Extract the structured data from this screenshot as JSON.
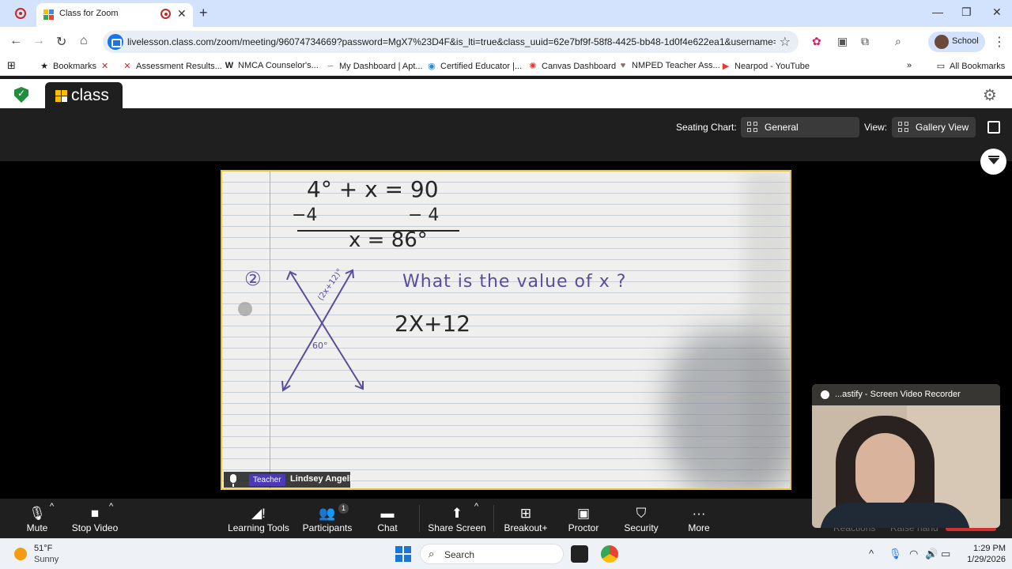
{
  "browser": {
    "tab_title": "Class for Zoom",
    "new_tab": "+",
    "url": "livelesson.class.com/zoom/meeting/96074734669?password=MgX7%23D4F&is_lti=true&class_uuid=62e7bf9f-58f8-4425-bb48-1d0f4e622ea1&username=Li...",
    "profile_label": "School",
    "window_controls": [
      "—",
      "❐",
      "✕"
    ]
  },
  "bookmarks": [
    {
      "label": "Bookmarks",
      "icon": "star-icon"
    },
    {
      "label": "",
      "icon": "x-logo-icon"
    },
    {
      "label": "Assessment Results...",
      "icon": "x-logo-icon"
    },
    {
      "label": "NMCA Counselor's...",
      "icon": "w-logo-icon"
    },
    {
      "label": "My Dashboard | Apt...",
      "icon": "wave-icon"
    },
    {
      "label": "Certified Educator |...",
      "icon": "circle-icon"
    },
    {
      "label": "Canvas Dashboard",
      "icon": "canvas-icon"
    },
    {
      "label": "NMPED Teacher Ass...",
      "icon": "badge-icon"
    },
    {
      "label": "Nearpod - YouTube",
      "icon": "youtube-icon"
    }
  ],
  "all_bookmarks": "All Bookmarks",
  "class_app": {
    "logo_text": "class",
    "seating_chart_label": "Seating Chart:",
    "seating_chart_value": "General",
    "view_label": "View:",
    "view_value": "Gallery View"
  },
  "video": {
    "badge": "Teacher",
    "participant_name": "Lindsey Angell",
    "whiteboard": {
      "eq_line1": "4° + x = 90",
      "eq_line2_left": "−4",
      "eq_line2_right": "− 4",
      "eq_line3": "x = 86°",
      "problem_number": "②",
      "question": "What is the value of x ?",
      "expression": "2X+12",
      "angle_upper": "(2x+12)°",
      "angle_lower": "60°"
    }
  },
  "webcam": {
    "title": "...astify - Screen Video Recorder"
  },
  "zoom_toolbar": {
    "mute": "Mute",
    "stop_video": "Stop Video",
    "learning_tools": "Learning Tools",
    "participants": "Participants",
    "participants_count": "1",
    "chat": "Chat",
    "share_screen": "Share Screen",
    "breakout": "Breakout+",
    "proctor": "Proctor",
    "security": "Security",
    "more": "More",
    "reactions": "Reactions",
    "raise_hand": "Raise hand"
  },
  "taskbar": {
    "temperature": "51°F",
    "condition": "Sunny",
    "search_placeholder": "Search",
    "time": "1:29 PM",
    "date": "1/29/2026"
  }
}
